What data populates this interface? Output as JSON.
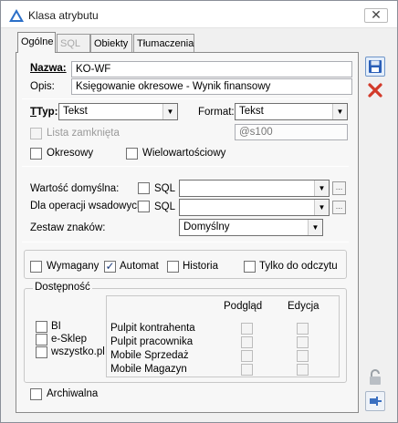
{
  "window": {
    "title": "Klasa atrybutu"
  },
  "tabs": [
    {
      "label": "Ogólne"
    },
    {
      "label": "SQL"
    },
    {
      "label": "Obiekty"
    },
    {
      "label": "Tłumaczenia"
    }
  ],
  "form": {
    "nazwa_label": "Nazwa:",
    "nazwa_value": "KO-WF",
    "opis_label": "Opis:",
    "opis_value": "Księgowanie okresowe - Wynik finansowy",
    "typ_label": "Typ:",
    "typ_value": "Tekst",
    "format_label": "Format:",
    "format_value": "Tekst",
    "lista_label": "Lista zamknięta",
    "format_mask": "@s100",
    "okresowy_label": "Okresowy",
    "wielowartosciowy_label": "Wielowartościowy",
    "wartosc_label": "Wartość domyślna:",
    "sql1_label": "SQL",
    "dla_label": "Dla operacji wsadowych:",
    "sql2_label": "SQL",
    "zestaw_label": "Zestaw znaków:",
    "zestaw_value": "Domyślny"
  },
  "flags": {
    "wymagany": "Wymagany",
    "automat": "Automat",
    "historia": "Historia",
    "tylko": "Tylko do odczytu"
  },
  "dostepnosc": {
    "legend": "Dostępność",
    "items": [
      "BI",
      "e-Sklep",
      "wszystko.pl"
    ],
    "col_podglad": "Podgląd",
    "col_edycja": "Edycja",
    "rows": [
      "Pulpit kontrahenta",
      "Pulpit pracownika",
      "Mobile Sprzedaż",
      "Mobile Magazyn"
    ]
  },
  "archiwalna_label": "Archiwalna",
  "colors": {
    "accent_blue": "#1f5fbf",
    "delete_red": "#d23a2a"
  }
}
